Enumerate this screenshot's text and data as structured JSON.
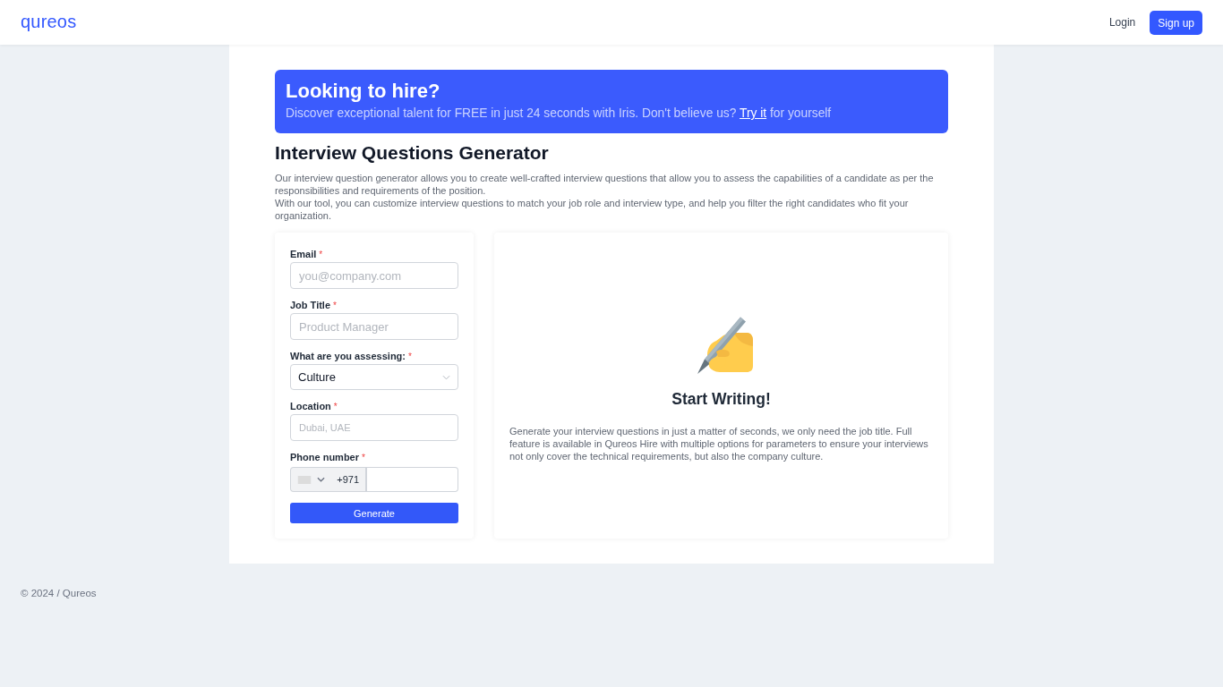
{
  "header": {
    "logo": "qureos",
    "actions": [
      {
        "kind": "link",
        "label": "Login"
      },
      {
        "kind": "button",
        "label": "Sign up"
      }
    ]
  },
  "banner": {
    "title": "Looking to hire?",
    "text_before": "Discover exceptional talent for FREE in just 24 seconds with Iris. Don't believe us?",
    "link": "Try it",
    "text_after": "for yourself"
  },
  "page": {
    "title": "Interview Questions Generator",
    "intro": [
      "Our interview question generator allows you to create well-crafted interview questions that allow you to assess the capabilities of a candidate as per the responsibilities and requirements of the position.",
      "With our tool, you can customize interview questions to match your job role and interview type, and help you filter the right candidates who fit your organization."
    ]
  },
  "form": {
    "fields": [
      {
        "kind": "input",
        "label": "Email",
        "required_mark": "*",
        "placeholder": "you@company.com"
      },
      {
        "kind": "input",
        "label": "Job Title",
        "required_mark": "*",
        "placeholder": "Product Manager"
      },
      {
        "kind": "select",
        "label": "What are you assessing:",
        "required_mark": "*",
        "value": "Culture"
      },
      {
        "kind": "autocomplete",
        "label": "Location",
        "required_mark": "*",
        "placeholder": "Dubai, UAE"
      },
      {
        "kind": "phone",
        "label": "Phone number",
        "required_mark": "*",
        "dial_code": "+971"
      }
    ],
    "submit": "Generate"
  },
  "preview": {
    "title": "Start Writing!",
    "text": "Generate your interview questions in just a matter of seconds, we only need the job title. Full feature is available in Qureos Hire with multiple options for parameters to ensure your interviews not only cover the technical requirements, but also the company culture."
  },
  "footer": {
    "text": "© 2024 / Qureos"
  }
}
